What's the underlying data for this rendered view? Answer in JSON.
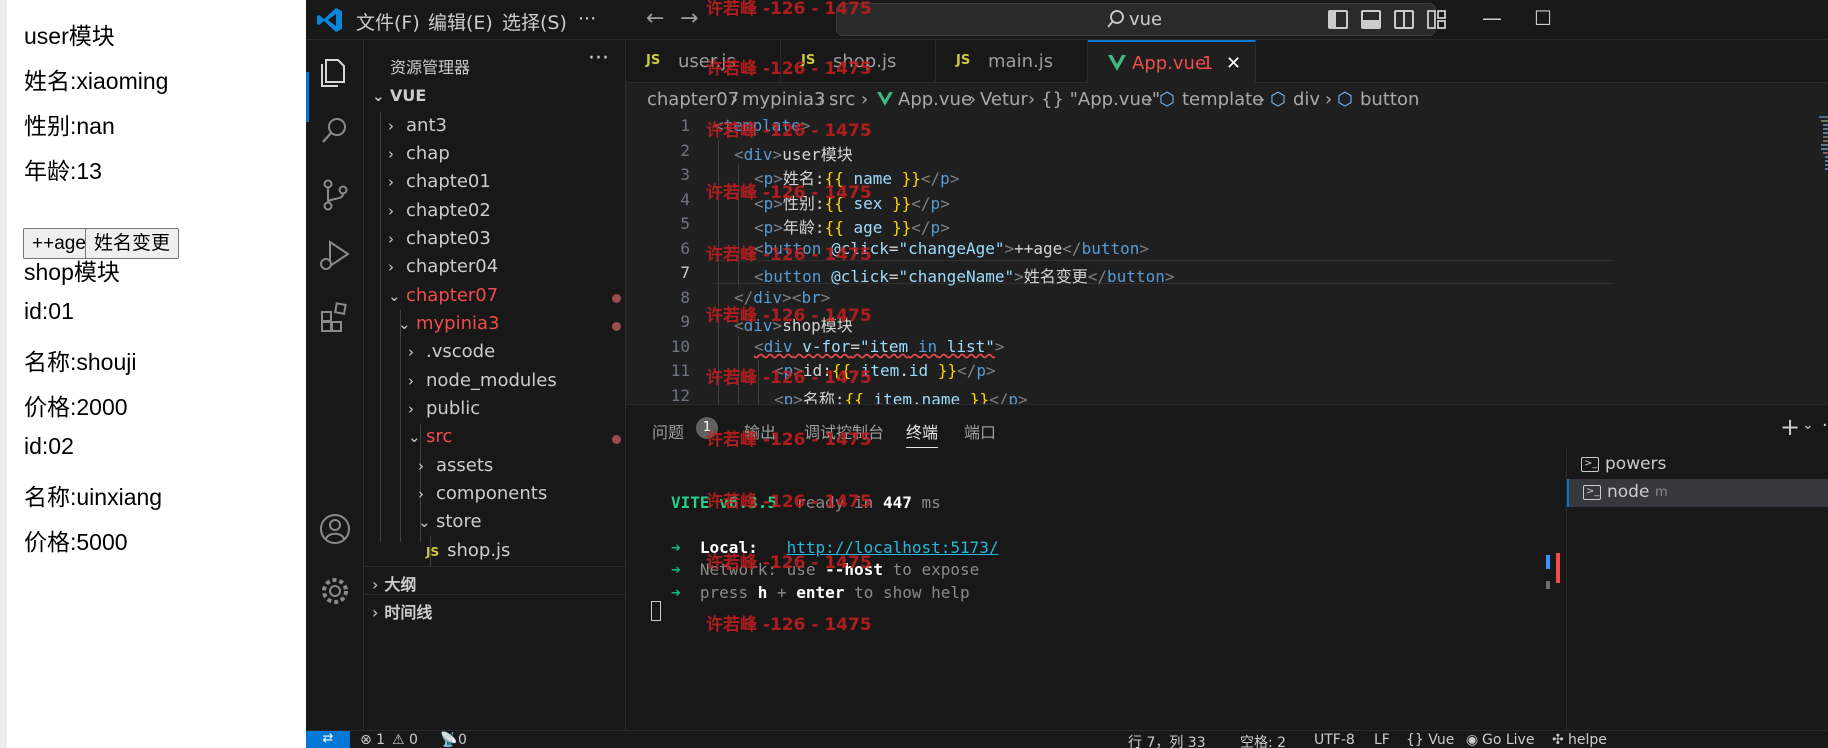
{
  "preview": {
    "user_title": "user模块",
    "name_line": "姓名:xiaoming",
    "sex_line": "性别:nan",
    "age_line": "年龄:13",
    "btn_age": "++age",
    "btn_name": "姓名变更",
    "shop_title": "shop模块",
    "items": [
      {
        "id_line": "id:01",
        "name_line": "名称:shouji",
        "price_line": "价格:2000"
      },
      {
        "id_line": "id:02",
        "name_line": "名称:uinxiang",
        "price_line": "价格:5000"
      }
    ]
  },
  "titlebar": {
    "menus": [
      "文件(F)",
      "编辑(E)",
      "选择(S)",
      "···"
    ],
    "search_text": "vue",
    "colors": {
      "accent": "#0078d4",
      "bg": "#181818"
    }
  },
  "sidebar": {
    "title": "资源管理器",
    "more": "···",
    "root": "VUE",
    "items": [
      "ant3",
      "chap",
      "chapte01",
      "chapte02",
      "chapte03",
      "chapter04",
      "chapter07",
      "mypinia3",
      ".vscode",
      "node_modules",
      "public",
      "src",
      "assets",
      "components",
      "store",
      "shop.js"
    ],
    "sections": [
      "大纲",
      "时间线"
    ]
  },
  "tabs": [
    {
      "label": "user.js",
      "badge": "JS"
    },
    {
      "label": "shop.js",
      "badge": "JS"
    },
    {
      "label": "main.js",
      "badge": "JS"
    },
    {
      "label": "App.vue",
      "count": "1",
      "close": "✕"
    }
  ],
  "breadcrumb": [
    "chapter07",
    "mypinia3",
    "src",
    "App.vue",
    "Vetur",
    "{} \"App.vue\"",
    "template",
    "div",
    "button"
  ],
  "editor": {
    "line_numbers": [
      "1",
      "2",
      "3",
      "4",
      "5",
      "6",
      "7",
      "8",
      "9",
      "10",
      "11",
      "12"
    ],
    "current_line": "7"
  },
  "panel": {
    "tabs": [
      "问题",
      "输出",
      "调试控制台",
      "终端",
      "端口"
    ],
    "problems_count": "1",
    "terminal": {
      "vite": "VITE v6.3.5",
      "ready": "ready in",
      "ready_ms": "447",
      "ms": "ms",
      "arrow": "➜",
      "local_label": "Local:",
      "local_url": "http://localhost:5173/",
      "network_label": "Network:",
      "network_use": "use",
      "network_host": "--host",
      "network_expose": "to expose",
      "help_press": "press",
      "help_h": "h",
      "help_plus": "+",
      "help_enter": "enter",
      "help_rest": "to show help"
    },
    "terminals": [
      "powers",
      "node"
    ],
    "node_suffix": "m"
  },
  "statusbar": {
    "errors": "⊗ 1",
    "warnings": "⚠ 0",
    "ports": "0",
    "position": "行 7，列 33",
    "spaces": "空格: 2",
    "encoding": "UTF-8",
    "eol": "LF",
    "language": "{} Vue",
    "golive": "Go Live",
    "helper": "helpe"
  },
  "watermark": "许若峰 -126 - 1475"
}
